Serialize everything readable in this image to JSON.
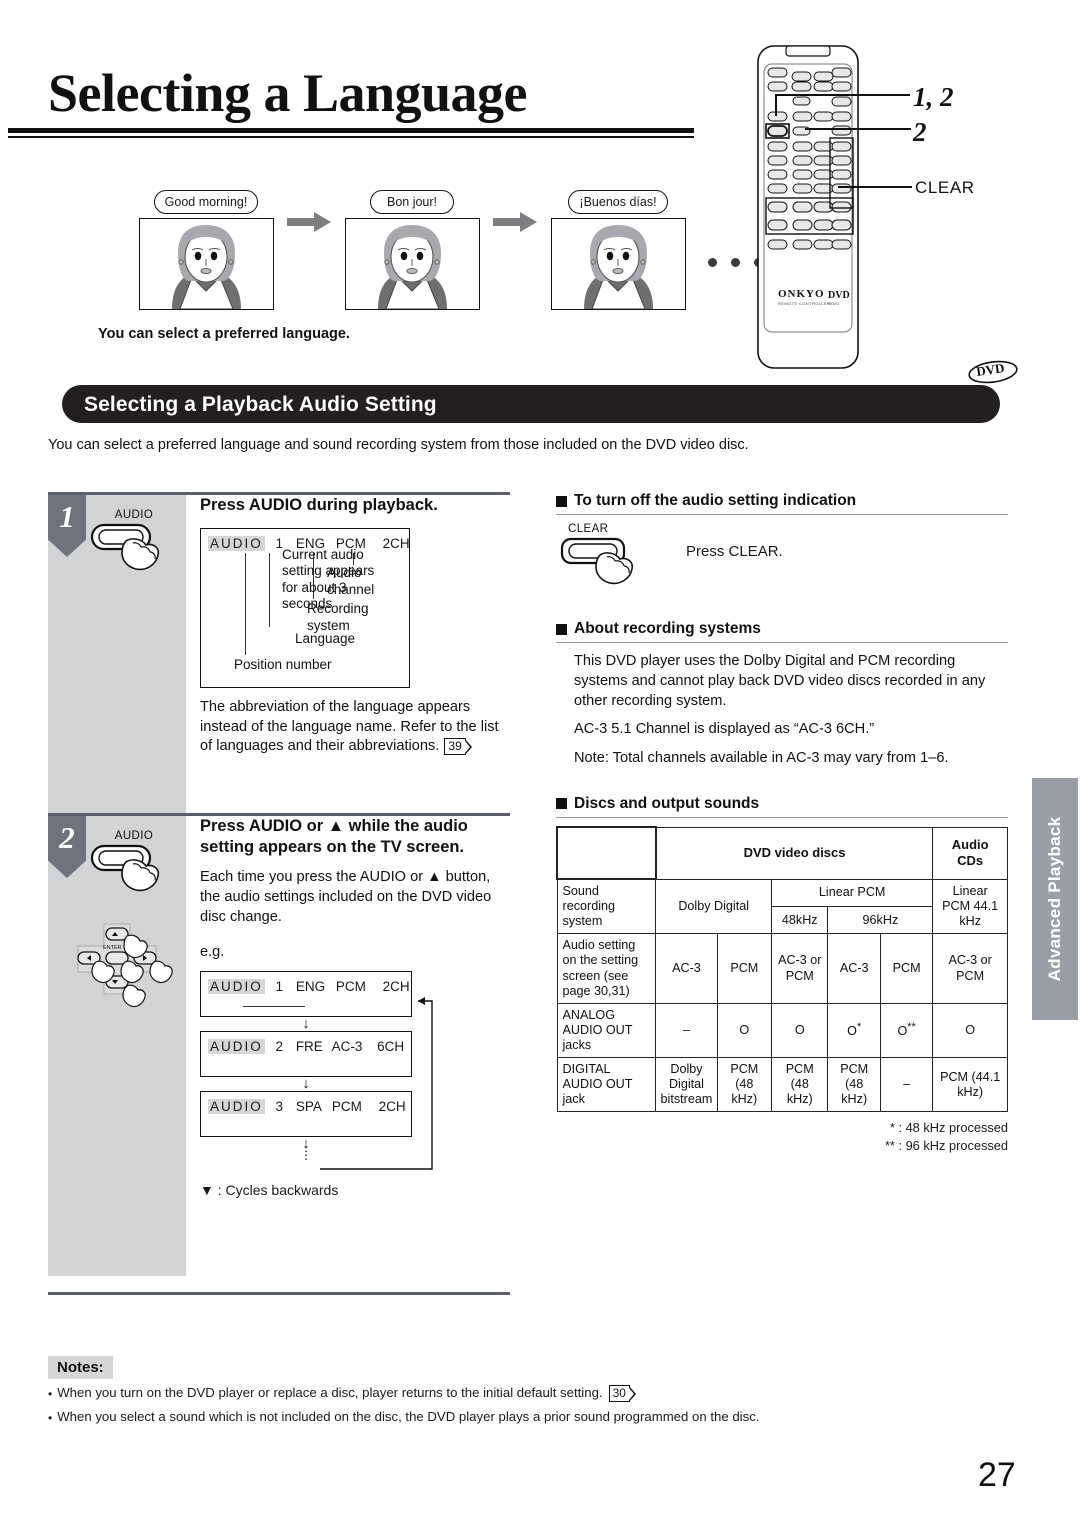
{
  "page": {
    "title": "Selecting a Language",
    "number": "27",
    "side_tab": "Advanced Playback"
  },
  "intro_illustration": {
    "bubbles": [
      "Good morning!",
      "Bon jour!",
      "¡Buenos días!"
    ],
    "caption": "You can select a preferred language.",
    "trailing_dots": 5
  },
  "remote": {
    "brand": "ONKYO",
    "brand_sub": "REMOTE CONTROLLER",
    "logo": "DVD",
    "callouts": {
      "steps_12": "1, 2",
      "step_2": "2",
      "clear": "CLEAR"
    }
  },
  "section": {
    "banner_title": "Selecting a Playback Audio Setting",
    "badge": "DVD",
    "intro": "You can select a preferred language and sound recording system from those included on the DVD video disc."
  },
  "steps": [
    {
      "number": "1",
      "button_label": "AUDIO",
      "heading": "Press AUDIO during playback.",
      "osd": {
        "audio": "AUDIO",
        "position": "1",
        "language": "ENG",
        "system": "PCM",
        "channel": "2CH"
      },
      "leaders": {
        "audio_channel": "Audio\nchannel",
        "recording_system": "Recording\nsystem",
        "language": "Language",
        "position_number": "Position number",
        "current_setting": "Current audio setting appears for about 3 seconds"
      },
      "note": "The abbreviation of the language appears instead of the language name. Refer to the list of languages and their abbreviations.",
      "note_pageref": "39"
    },
    {
      "number": "2",
      "button_label": "AUDIO",
      "enter_label": "ENTER",
      "heading": "Press AUDIO or ▲ while the audio setting appears on the TV screen.",
      "body": "Each time you press the AUDIO or ▲ button, the audio settings included on the DVD video disc change.",
      "eg_label": "e.g.",
      "cycle": [
        {
          "audio": "AUDIO",
          "position": "1",
          "language": "ENG",
          "system": "PCM",
          "channel": "2CH"
        },
        {
          "audio": "AUDIO",
          "position": "2",
          "language": "FRE",
          "system": "AC-3",
          "channel": "6CH"
        },
        {
          "audio": "AUDIO",
          "position": "3",
          "language": "SPA",
          "system": "PCM",
          "channel": "2CH"
        }
      ],
      "legend": "▼ : Cycles backwards"
    }
  ],
  "right_sections": [
    {
      "heading": "To turn off the audio setting indication",
      "button_label": "CLEAR",
      "instruction": "Press CLEAR."
    },
    {
      "heading": "About recording systems",
      "paragraphs": [
        "This DVD player uses the Dolby Digital and PCM recording systems and cannot play back DVD video discs recorded in any other recording system.",
        "AC-3 5.1 Channel is displayed as “AC-3 6CH.”",
        "Note: Total channels available in AC-3 may vary from 1–6."
      ]
    },
    {
      "heading": "Discs and output sounds"
    }
  ],
  "chart_data": {
    "type": "table",
    "title": "Discs and output sounds",
    "col_groups": [
      "",
      "DVD video discs",
      "Audio CDs"
    ],
    "rows": [
      {
        "label": "Sound recording system",
        "cells": [
          "Dolby Digital",
          "Linear PCM",
          "48kHz",
          "96kHz",
          "Linear PCM 44.1 kHz"
        ]
      },
      {
        "label": "Audio setting on the setting screen (see page 30,31)",
        "cells": [
          "AC-3",
          "PCM",
          "AC-3 or PCM",
          "AC-3",
          "PCM",
          "AC-3 or PCM"
        ]
      },
      {
        "label": "ANALOG AUDIO OUT jacks",
        "cells": [
          "–",
          "O",
          "O",
          "O*",
          "O**",
          "O"
        ]
      },
      {
        "label": "DIGITAL AUDIO OUT jack",
        "cells": [
          "Dolby Digital bitstream",
          "PCM (48 kHz)",
          "PCM (48 kHz)",
          "PCM (48 kHz)",
          "–",
          "PCM (44.1 kHz)"
        ]
      }
    ],
    "footnotes": [
      "* :  48 kHz processed",
      "** : 96 kHz processed"
    ]
  },
  "table_text": {
    "hdr_dvd": "DVD video discs",
    "hdr_cd": "Audio CDs",
    "r1_label": "Sound recording system",
    "r1_dolby": "Dolby Digital",
    "r1_linear": "Linear PCM",
    "r1_48": "48kHz",
    "r1_96": "96kHz",
    "r1_cd": "Linear PCM 44.1 kHz",
    "r2_label": "Audio setting on the setting screen (see page 30,31)",
    "r2_c1": "AC-3",
    "r2_c2": "PCM",
    "r2_c3": "AC-3 or PCM",
    "r2_c4": "AC-3",
    "r2_c5": "PCM",
    "r2_c6": "AC-3 or PCM",
    "r3_label": "ANALOG AUDIO OUT jacks",
    "r3_c1": "–",
    "r3_c2": "O",
    "r3_c3": "O",
    "r3_c4": "O",
    "r3_c5": "O",
    "r3_c6": "O",
    "r4_label": "DIGITAL AUDIO OUT jack",
    "r4_c1": "Dolby Digital bitstream",
    "r4_c2": "PCM (48 kHz)",
    "r4_c3": "PCM (48 kHz)",
    "r4_c4": "PCM (48 kHz)",
    "r4_c5": "–",
    "r4_c6": "PCM (44.1 kHz)",
    "foot1": "* :  48 kHz processed",
    "foot2": "** : 96 kHz processed"
  },
  "notes": {
    "badge": "Notes:",
    "items": [
      {
        "text": "When you turn on the DVD player or replace a disc, player returns to the initial default setting.",
        "pageref": "30"
      },
      {
        "text": "When you select a sound which is not included on the disc, the DVD player plays a prior sound programmed on the disc.",
        "pageref": ""
      }
    ]
  },
  "colors": {
    "banner_bg": "#231f20",
    "step_gutter": "#d2d3d5",
    "step_num_bg": "#6e727c",
    "side_tab_bg": "#9a9ea6",
    "rule": "#5b5f6b"
  }
}
